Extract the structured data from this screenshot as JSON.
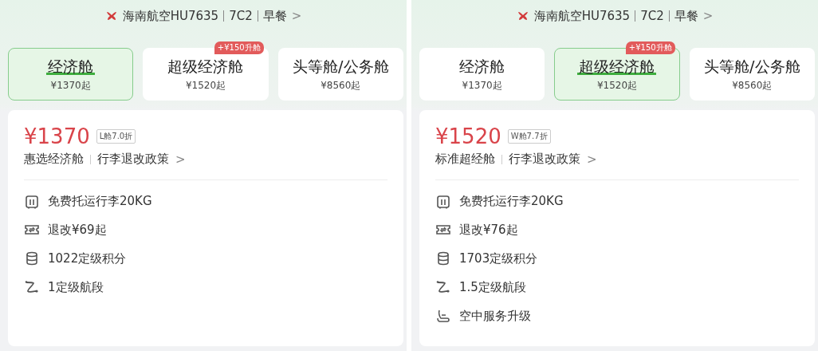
{
  "panels": [
    {
      "header": {
        "airline": "海南航空HU7635",
        "aircraft": "7C2",
        "meal": "早餐",
        "chevron": ">"
      },
      "tabs": [
        {
          "label": "经济舱",
          "price": "¥1370起",
          "selected": true
        },
        {
          "label": "超级经济舱",
          "price": "¥1520起",
          "badge": "+¥150升舱",
          "selected": false
        },
        {
          "label": "头等舱/公务舱",
          "price": "¥8560起",
          "selected": false
        }
      ],
      "fare": {
        "price": "¥1370",
        "tag": "L舱7.0折",
        "name": "惠选经济舱",
        "policy": "行李退改政策",
        "chevron": ">"
      },
      "perks": [
        {
          "kind": "baggage",
          "text": "免费托运行李20KG"
        },
        {
          "kind": "refund",
          "text": "退改¥69起"
        },
        {
          "kind": "points",
          "text": "1022定级积分"
        },
        {
          "kind": "segment",
          "text": "1定级航段"
        }
      ]
    },
    {
      "header": {
        "airline": "海南航空HU7635",
        "aircraft": "7C2",
        "meal": "早餐",
        "chevron": ">"
      },
      "tabs": [
        {
          "label": "经济舱",
          "price": "¥1370起",
          "selected": false
        },
        {
          "label": "超级经济舱",
          "price": "¥1520起",
          "badge": "+¥150升舱",
          "selected": true
        },
        {
          "label": "头等舱/公务舱",
          "price": "¥8560起",
          "selected": false
        }
      ],
      "fare": {
        "price": "¥1520",
        "tag": "W舱7.7折",
        "name": "标准超经舱",
        "policy": "行李退改政策",
        "chevron": ">"
      },
      "perks": [
        {
          "kind": "baggage",
          "text": "免费托运行李20KG"
        },
        {
          "kind": "refund",
          "text": "退改¥76起"
        },
        {
          "kind": "points",
          "text": "1703定级积分"
        },
        {
          "kind": "segment",
          "text": "1.5定级航段"
        },
        {
          "kind": "seat",
          "text": "空中服务升级"
        }
      ]
    }
  ]
}
